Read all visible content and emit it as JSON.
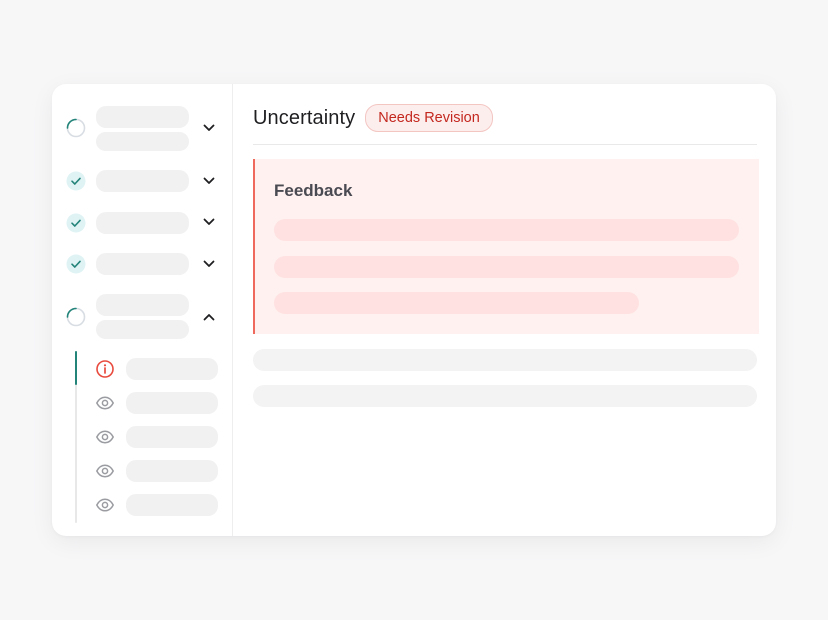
{
  "header": {
    "title": "Uncertainty",
    "badge": "Needs Revision"
  },
  "feedback": {
    "title": "Feedback"
  },
  "sidebar": {
    "items": [
      {
        "status": "in-progress",
        "expanded": false
      },
      {
        "status": "completed",
        "expanded": false
      },
      {
        "status": "completed",
        "expanded": false
      },
      {
        "status": "completed",
        "expanded": false
      },
      {
        "status": "in-progress",
        "expanded": true
      }
    ],
    "sub_items": [
      {
        "icon": "alert-info-icon",
        "active": true
      },
      {
        "icon": "eye-icon",
        "active": false
      },
      {
        "icon": "eye-icon",
        "active": false
      },
      {
        "icon": "eye-icon",
        "active": false
      },
      {
        "icon": "eye-icon",
        "active": false
      }
    ]
  },
  "colors": {
    "accent": "#23847a",
    "check_bg": "#dff3f5",
    "error": "#e84a3d",
    "badge_text": "#c3281f",
    "feedback_bg": "#fff1f0"
  }
}
